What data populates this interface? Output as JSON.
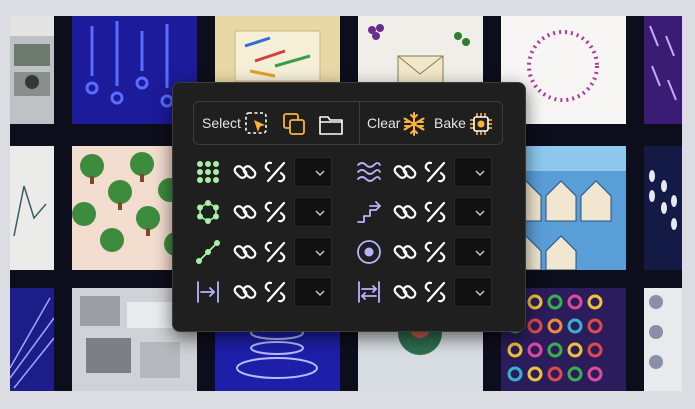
{
  "toolbar": {
    "select_label": "Select",
    "clear_label": "Clear",
    "bake_label": "Bake"
  },
  "icons": {
    "select": "dashed-select-cursor-icon",
    "duplicate": "duplicate-squares-icon",
    "folder": "folder-icon",
    "clear": "snowflake-icon",
    "bake": "chip-icon",
    "link": "link-icon",
    "unlink": "unlink-icon",
    "chevron": "chevron-down-icon"
  },
  "modifiers": {
    "left": [
      {
        "name": "grid-dots-icon"
      },
      {
        "name": "ring-dots-icon"
      },
      {
        "name": "line-dots-icon"
      },
      {
        "name": "arrow-to-bar-icon"
      }
    ],
    "right": [
      {
        "name": "waves-icon"
      },
      {
        "name": "stairs-arrow-icon"
      },
      {
        "name": "target-circle-icon"
      },
      {
        "name": "spread-arrows-icon"
      }
    ],
    "dropdowns": [
      "",
      "",
      "",
      "",
      "",
      "",
      "",
      ""
    ]
  },
  "colors": {
    "panel_bg": "#1f1f1f",
    "green_accent": "#a6f0a8",
    "purple_accent": "#b7b4ff",
    "orange_accent": "#ffb23a",
    "icon_light": "#e8e8e8"
  }
}
